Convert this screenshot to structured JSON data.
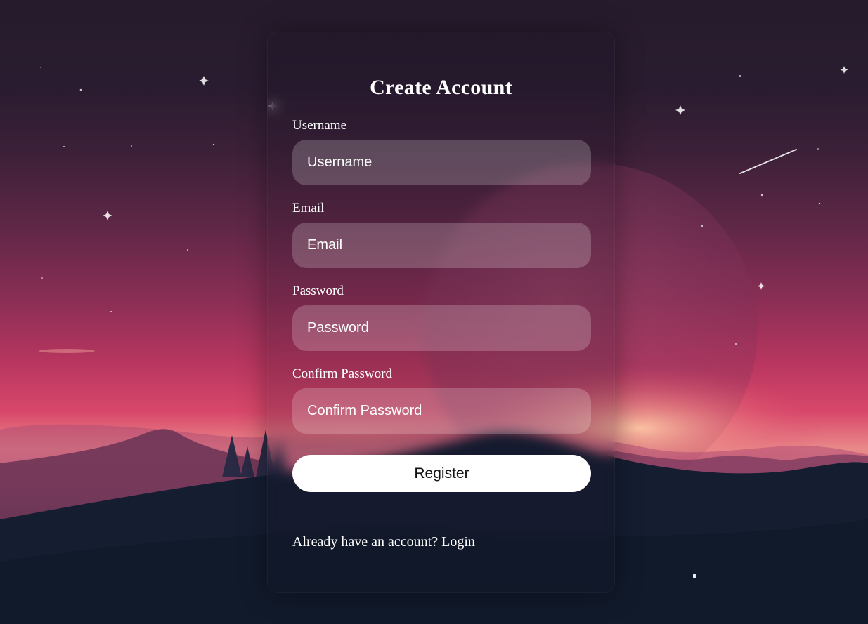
{
  "form": {
    "title": "Create Account",
    "fields": [
      {
        "label": "Username",
        "placeholder": "Username",
        "value": ""
      },
      {
        "label": "Email",
        "placeholder": "Email",
        "value": ""
      },
      {
        "label": "Password",
        "placeholder": "Password",
        "value": ""
      },
      {
        "label": "Confirm Password",
        "placeholder": "Confirm Password",
        "value": ""
      }
    ],
    "register_label": "Register",
    "footer_prompt": "Already have an account?",
    "footer_link": "Login"
  },
  "colors": {
    "sky_top": "#251b2c",
    "sky_horizon": "#d8476a",
    "ground": "#141b2c",
    "button_bg": "#ffffff",
    "text": "#ffffff"
  }
}
